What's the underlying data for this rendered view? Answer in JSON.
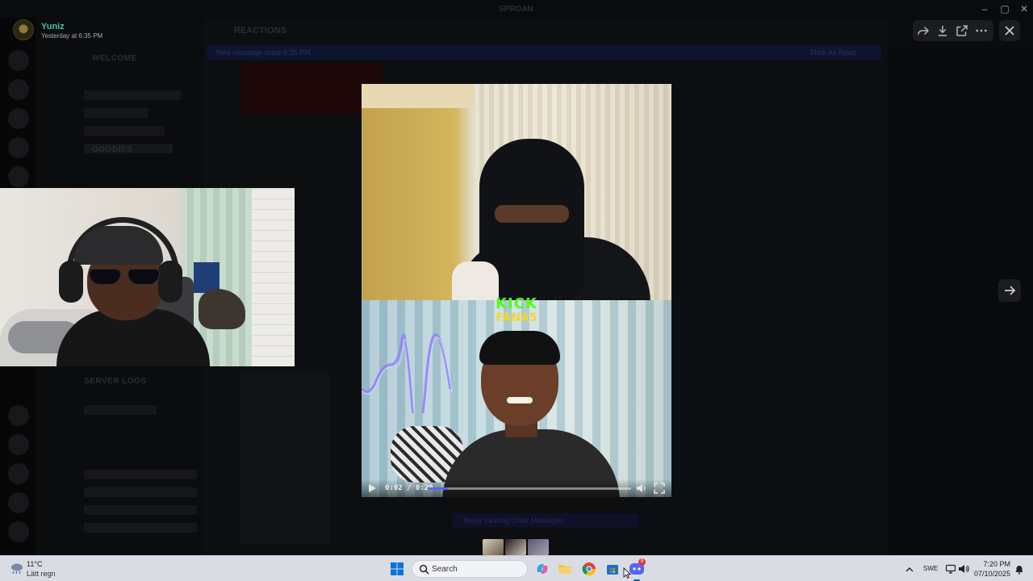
{
  "window": {
    "title": "SPROAN"
  },
  "background": {
    "channel_header": "REACTIONS",
    "categories": [
      "WELCOME",
      "GOODIES",
      "SERVER LOGS"
    ],
    "notice_bar_text": "New message since 6:35 PM",
    "notice_bar_action": "Mark As Read",
    "composer_text": "Reply Viewing Older Messages"
  },
  "author": {
    "name": "Yuniz",
    "timestamp": "Yesterday at 6:35 PM"
  },
  "viewer": {
    "toolbar": {
      "forward_icon": "forward-icon",
      "download_icon": "download-icon",
      "open_icon": "open-external-icon",
      "more_icon": "more-icon"
    },
    "close_icon": "close-icon",
    "next_icon": "arrow-right-icon"
  },
  "video": {
    "overlay_brand": "KICK",
    "overlay_name": "FANA5",
    "current_time": "0:02",
    "duration": "0:20",
    "time_display": "0:02 / 0:20",
    "progress": 0.1
  },
  "taskbar": {
    "weather_temp": "11°C",
    "weather_condition": "Lätt regn",
    "search_placeholder": "Search",
    "language": "SWE",
    "time": "7:20 PM",
    "date": "07/10/2025",
    "discord_badge": "9",
    "apps": [
      "copilot-icon",
      "file-explorer-icon",
      "chrome-icon",
      "store-icon",
      "discord-icon"
    ]
  },
  "colors": {
    "author_name": "#3fc6a6",
    "progress_fill": "#5865f2",
    "kick_green": "#53fc18",
    "fana_yellow": "#f5d62a",
    "taskbar_bg": "#d9dde3"
  }
}
